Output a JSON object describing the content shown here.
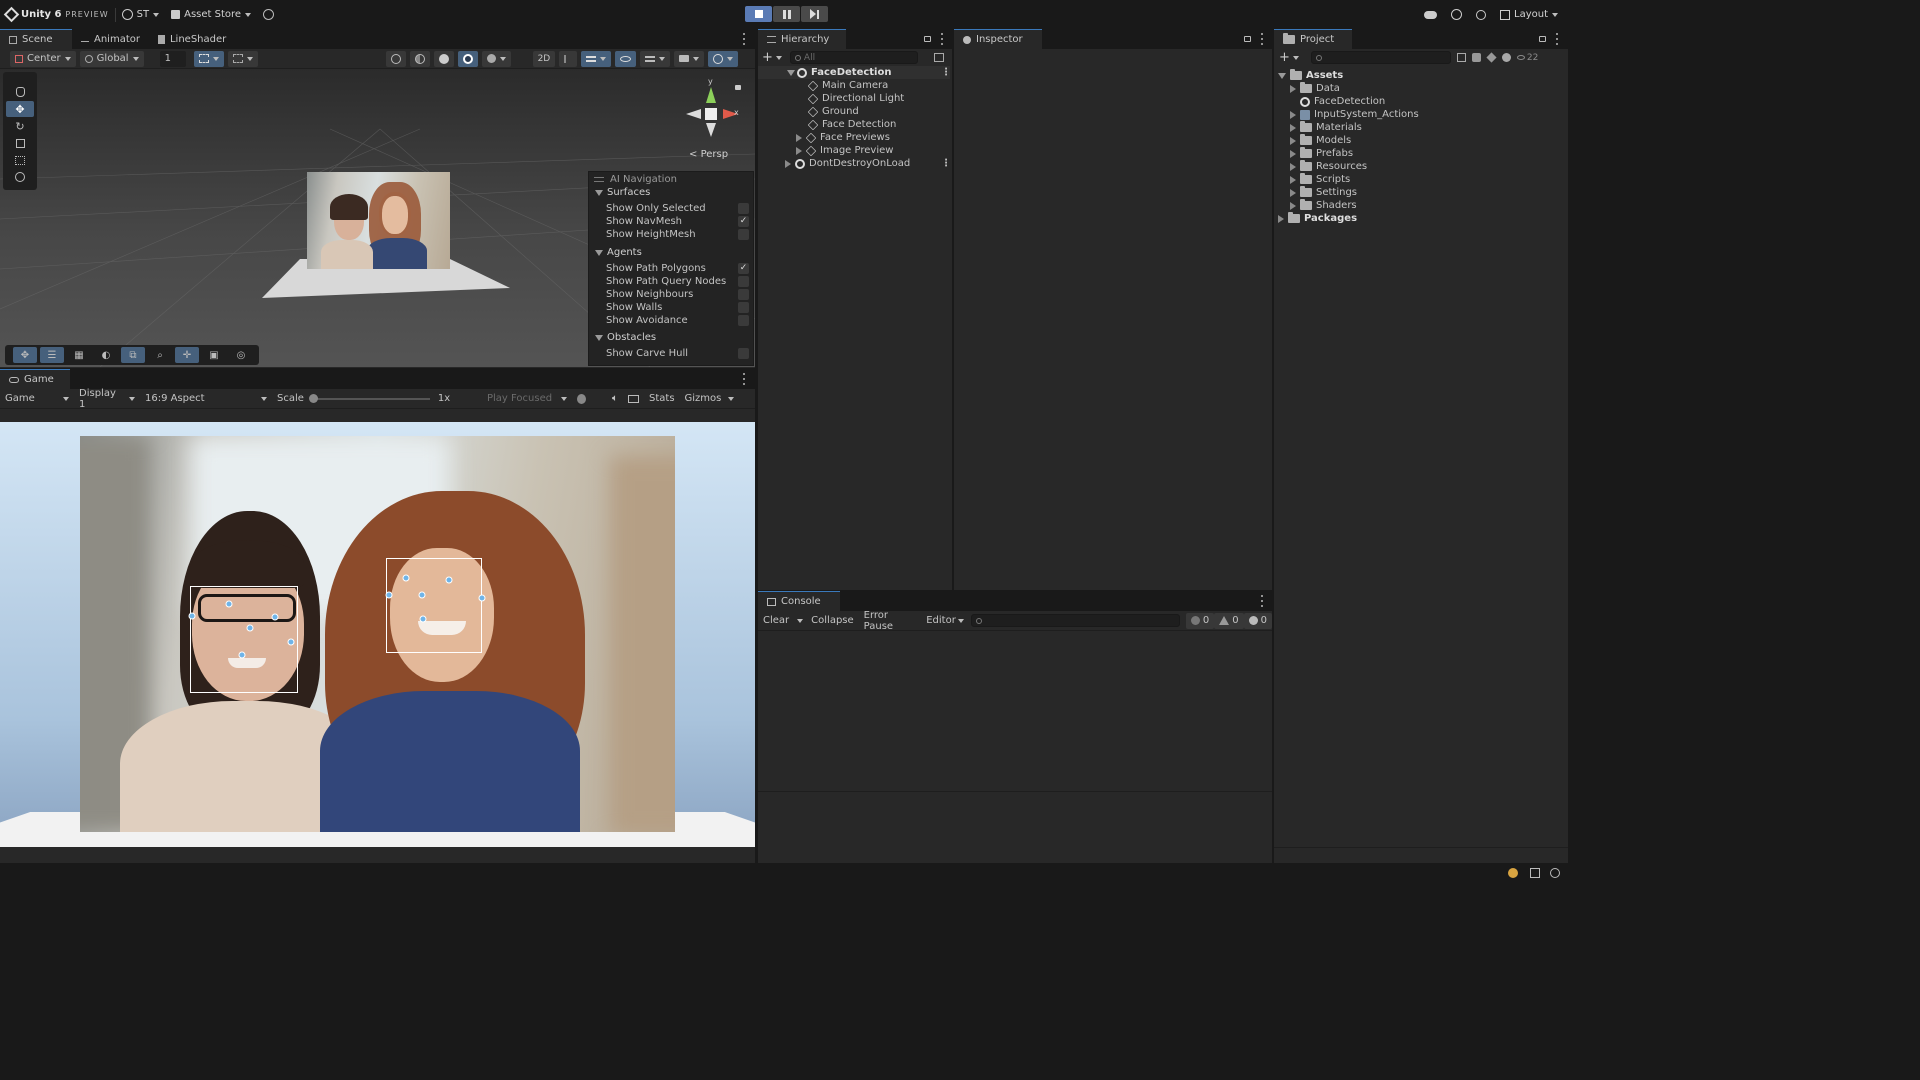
{
  "topbar": {
    "logo_text": "Unity 6",
    "preview_text": "PREVIEW",
    "account": "ST",
    "asset_store": "Asset Store",
    "layout": "Layout"
  },
  "scene_panel": {
    "tabs": [
      "Scene",
      "Animator",
      "LineShader"
    ],
    "pivot": "Center",
    "space": "Global",
    "grid_snap": "1",
    "persp_label": "Persp",
    "gizmo_y": "y",
    "gizmo_x": "x"
  },
  "ai_navigation": {
    "title": "AI Navigation",
    "sections": [
      {
        "name": "Surfaces",
        "items": [
          {
            "label": "Show Only Selected",
            "checked": false
          },
          {
            "label": "Show NavMesh",
            "checked": true
          },
          {
            "label": "Show HeightMesh",
            "checked": false
          }
        ]
      },
      {
        "name": "Agents",
        "items": [
          {
            "label": "Show Path Polygons",
            "checked": true
          },
          {
            "label": "Show Path Query Nodes",
            "checked": false
          },
          {
            "label": "Show Neighbours",
            "checked": false
          },
          {
            "label": "Show Walls",
            "checked": false
          },
          {
            "label": "Show Avoidance",
            "checked": false
          }
        ]
      },
      {
        "name": "Obstacles",
        "items": [
          {
            "label": "Show Carve Hull",
            "checked": false
          }
        ]
      }
    ]
  },
  "game_panel": {
    "tab": "Game",
    "view_select": "Game",
    "display": "Display 1",
    "aspect": "16:9 Aspect",
    "scale_label": "Scale",
    "scale_value": "1x",
    "play_mode": "Play Focused",
    "stats": "Stats",
    "gizmos": "Gizmos"
  },
  "hierarchy": {
    "tab": "Hierarchy",
    "search_placeholder": "All",
    "scene": "FaceDetection",
    "children": [
      "Main Camera",
      "Directional Light",
      "Ground",
      "Face Detection",
      "Face Previews",
      "Image Preview"
    ],
    "dont_destroy": "DontDestroyOnLoad"
  },
  "inspector": {
    "tab": "Inspector"
  },
  "project": {
    "tab": "Project",
    "count": "22",
    "assets_label": "Assets",
    "assets": [
      "Data",
      "FaceDetection",
      "InputSystem_Actions",
      "Materials",
      "Models",
      "Prefabs",
      "Resources",
      "Scripts",
      "Settings",
      "Shaders"
    ],
    "packages_label": "Packages"
  },
  "console": {
    "tab": "Console",
    "clear": "Clear",
    "collapse": "Collapse",
    "error_pause": "Error Pause",
    "editor": "Editor",
    "log_count": "0",
    "warn_count": "0",
    "error_count": "0"
  },
  "colors": {
    "accent": "#46607c",
    "landmark": "#6fb4e8",
    "panel": "#282828",
    "background": "#191919"
  }
}
